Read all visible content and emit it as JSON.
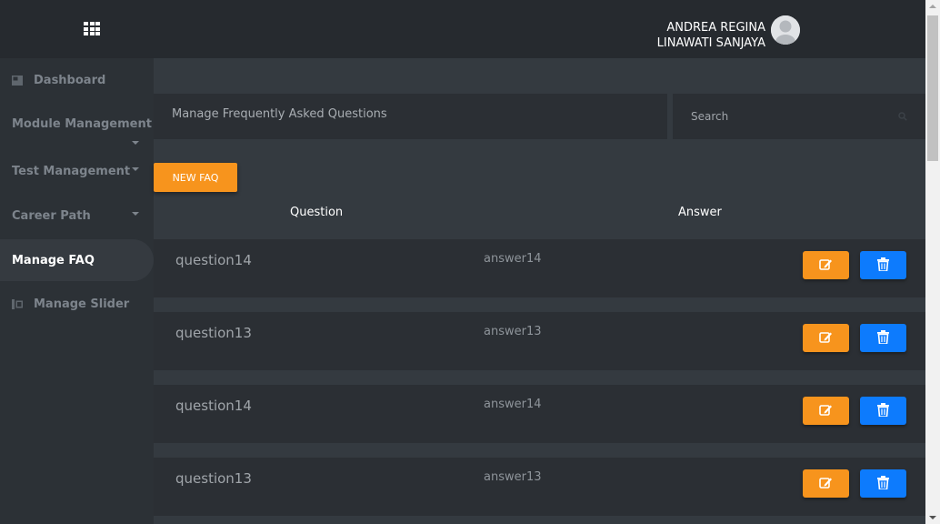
{
  "header": {
    "user_name_line1": "ANDREA REGINA",
    "user_name_line2": "LINAWATI SANJAYA",
    "menu_icon": "grid-icon",
    "avatar_icon": "user-avatar-icon"
  },
  "sidebar": {
    "items": [
      {
        "label": "Dashboard",
        "icon": "dashboard-icon"
      },
      {
        "label": "Module Management",
        "icon": "chevron-down-icon"
      },
      {
        "label": "Test Management",
        "icon": "chevron-down-icon"
      },
      {
        "label": "Career Path",
        "icon": "chevron-down-icon"
      },
      {
        "label": "Manage FAQ",
        "active": true
      },
      {
        "label": "Manage Slider",
        "icon": "slider-icon"
      }
    ]
  },
  "main": {
    "title": "Manage Frequently Asked Questions",
    "search_placeholder": "Search",
    "new_button": "NEW FAQ",
    "columns": {
      "question": "Question",
      "answer": "Answer"
    },
    "rows": [
      {
        "question": "question14",
        "answer": "answer14"
      },
      {
        "question": "question13",
        "answer": "answer13"
      },
      {
        "question": "question14",
        "answer": "answer14"
      },
      {
        "question": "question13",
        "answer": "answer13"
      }
    ]
  },
  "colors": {
    "accent_orange": "#f7941d",
    "accent_blue": "#0d7bfd",
    "topbar": "#262a2f",
    "content_bg": "#343a40"
  }
}
